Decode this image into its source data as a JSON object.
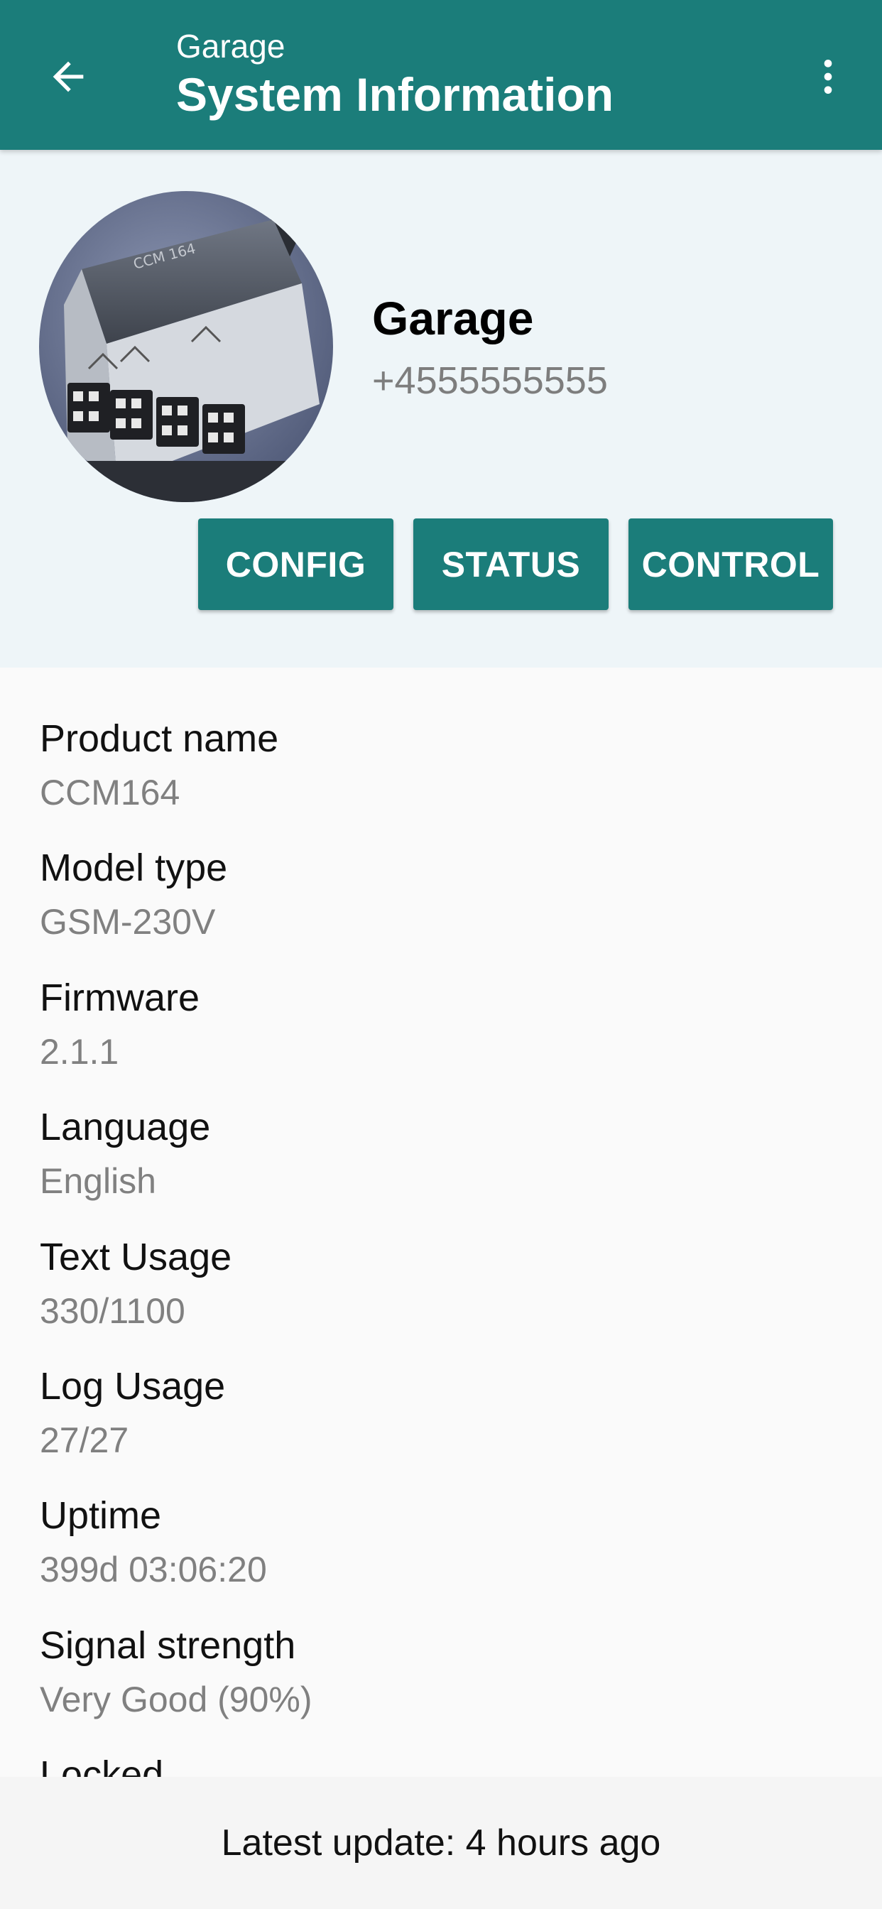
{
  "app_bar": {
    "subtitle": "Garage",
    "title": "System Information",
    "back_icon": "arrow-left-icon",
    "menu_icon": "more-vertical-icon",
    "background_color": "#1b7d7a"
  },
  "device": {
    "name": "Garage",
    "phone": "+4555555555",
    "image_icon": "device-photo"
  },
  "actions": {
    "config_label": "CONFIG",
    "status_label": "STATUS",
    "control_label": "CONTROL"
  },
  "info": [
    {
      "label": "Product name",
      "value": "CCM164"
    },
    {
      "label": "Model type",
      "value": "GSM-230V"
    },
    {
      "label": "Firmware",
      "value": "2.1.1"
    },
    {
      "label": "Language",
      "value": "English"
    },
    {
      "label": "Text Usage",
      "value": "330/1100"
    },
    {
      "label": "Log Usage",
      "value": "27/27"
    },
    {
      "label": "Uptime",
      "value": "399d 03:06:20"
    },
    {
      "label": "Signal strength",
      "value": "Very Good (90%)"
    },
    {
      "label": "Locked",
      "value": ""
    }
  ],
  "footer": {
    "text": "Latest update: 4 hours ago"
  },
  "colors": {
    "accent": "#1b7d7a",
    "header_bg": "#eef5f8",
    "value_text": "#808080"
  }
}
